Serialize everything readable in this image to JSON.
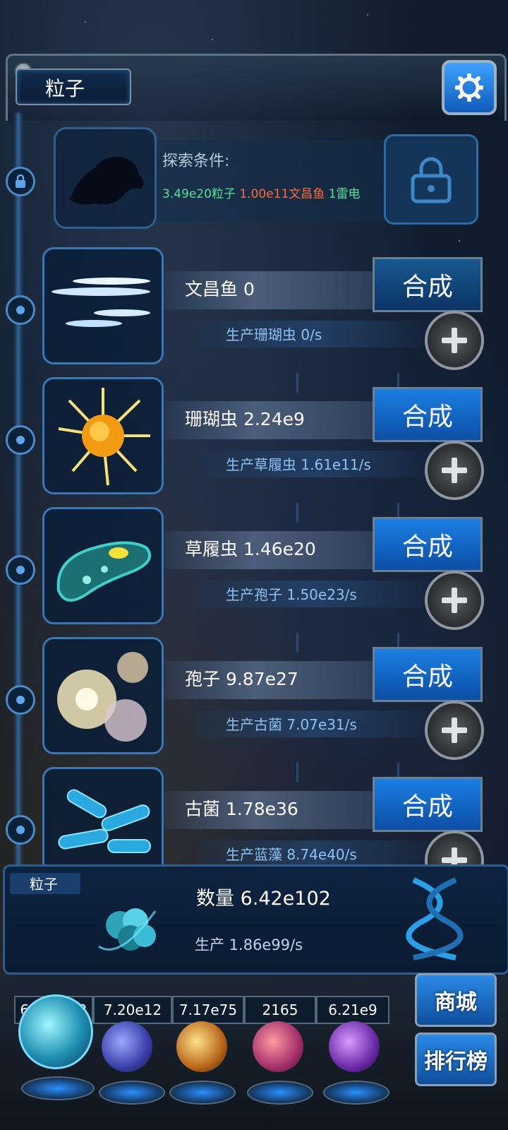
{
  "header": {
    "title": "粒子"
  },
  "explore": {
    "label": "探索条件:",
    "req_particles": "3.49e20粒子",
    "req_fish": "1.00e11文昌鱼",
    "req_thunder": "1雷电"
  },
  "creatures": [
    {
      "name": "文昌鱼 0",
      "produce": "生产珊瑚虫 0/s",
      "button": "合成"
    },
    {
      "name": "珊瑚虫 2.24e9",
      "produce": "生产草履虫 1.61e11/s",
      "button": "合成"
    },
    {
      "name": "草履虫 1.46e20",
      "produce": "生产孢子 1.50e23/s",
      "button": "合成"
    },
    {
      "name": "孢子 9.87e27",
      "produce": "生产古菌 7.07e31/s",
      "button": "合成"
    },
    {
      "name": "古菌 1.78e36",
      "produce": "生产蓝藻 8.74e40/s",
      "button": "合成"
    }
  ],
  "info": {
    "tab": "粒子",
    "count": "数量 6.42e102",
    "produce": "生产 1.86e99/s"
  },
  "resources": [
    "6.42e102",
    "7.20e12",
    "7.17e75",
    "2165",
    "6.21e9"
  ],
  "side_buttons": {
    "shop": "商城",
    "rank": "排行榜"
  },
  "colors": {
    "accent": "#1c7fe3",
    "green": "#53e39a",
    "red": "#ff6a3d"
  }
}
